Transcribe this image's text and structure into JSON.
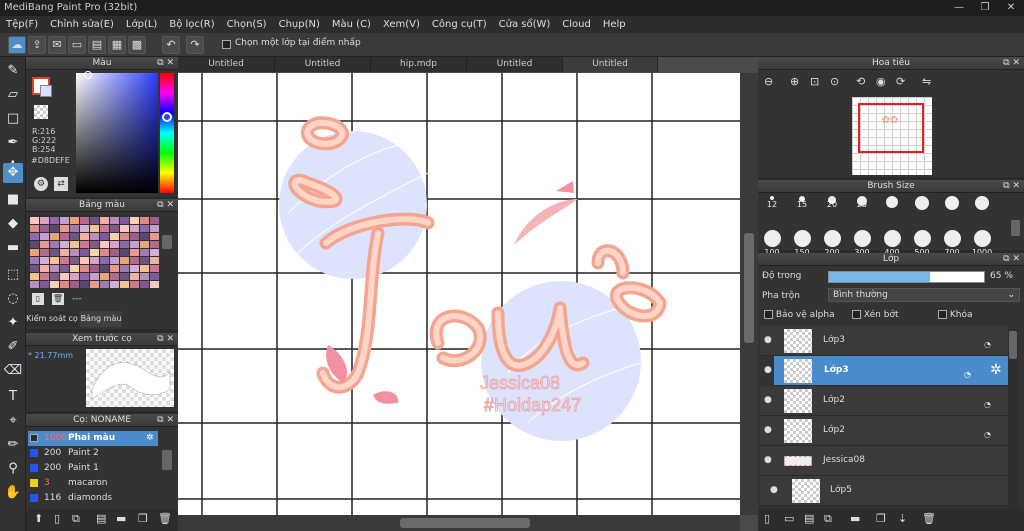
{
  "app": {
    "title": "MediBang Paint Pro (32bit)"
  },
  "menu": [
    "Tệp(F)",
    "Chỉnh sửa(E)",
    "Lớp(L)",
    "Bộ lọc(R)",
    "Chọn(S)",
    "Chụp(N)",
    "Màu (C)",
    "Xem(V)",
    "Công cụ(T)",
    "Cửa sổ(W)",
    "Cloud",
    "Help"
  ],
  "toolbar": {
    "select_layer_label": "Chọn một lớp tại điểm nhấp"
  },
  "doc_tabs": [
    "Untitled",
    "Untitled",
    "hip.mdp",
    "Untitled",
    "Untitled"
  ],
  "color_panel": {
    "title": "Màu",
    "r": "R:216",
    "g": "G:222",
    "b": "B:254",
    "hex": "#D8DEFE",
    "fg_color": "#d8defe"
  },
  "palette_panel": {
    "title": "Bảng màu",
    "footer": "---",
    "tab_control": "Kiểm soát cọ",
    "tab_palette": "Bảng màu"
  },
  "brush_preview": {
    "title": "Xem trước cọ",
    "size": "* 21.77mm"
  },
  "brush_list": {
    "title": "Cọ: NONAME",
    "items": [
      {
        "size": "1000",
        "name": "Phai màu",
        "color": "#2a2a2a"
      },
      {
        "size": "200",
        "name": "Paint 2",
        "color": "#2255ee"
      },
      {
        "size": "200",
        "name": "Paint 1",
        "color": "#2255ee"
      },
      {
        "size": "3",
        "name": "macaron",
        "color": "#e8d020"
      },
      {
        "size": "116",
        "name": "diamonds",
        "color": "#2255ee"
      }
    ]
  },
  "navigator": {
    "title": "Hoa tiêu"
  },
  "brush_size": {
    "title": "Brush Size",
    "row1": [
      "12",
      "15",
      "20",
      "25",
      "30",
      "40",
      "50",
      "70"
    ],
    "row2": [
      "100",
      "150",
      "200",
      "300",
      "400",
      "500",
      "700",
      "1000"
    ]
  },
  "layers": {
    "title": "Lớp",
    "opacity_label": "Độ trong",
    "opacity_value": "65 %",
    "opacity": 0.65,
    "blend_label": "Pha trộn",
    "blend_value": "Bình thường",
    "protect_alpha": "Bảo vệ alpha",
    "clip": "Xén bớt",
    "lock": "Khóa",
    "items": [
      {
        "name": "Lớp3",
        "selected": false
      },
      {
        "name": "Lớp3",
        "selected": true
      },
      {
        "name": "Lớp2",
        "selected": false
      },
      {
        "name": "Lớp2",
        "selected": false
      },
      {
        "name": "Jessica08",
        "selected": false
      },
      {
        "name": "Lớp5",
        "selected": false
      }
    ]
  },
  "canvas_art": {
    "main_text": "Tối",
    "watermark_1": "Jessica08",
    "watermark_2": "#Hoidap247"
  }
}
